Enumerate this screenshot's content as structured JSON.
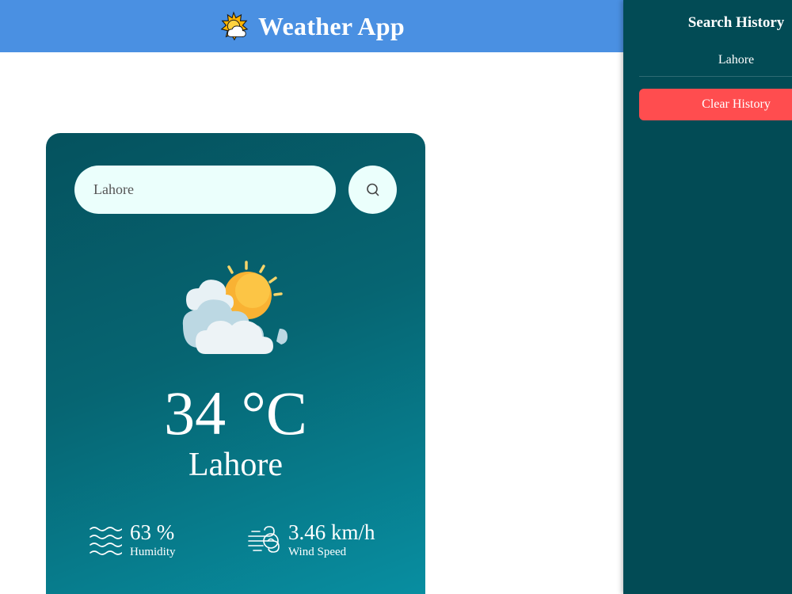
{
  "header": {
    "title": "Weather App",
    "logo_icon": "sun-cloud-icon",
    "background": "#4a90e2"
  },
  "sidebar": {
    "title": "Search History",
    "history": [
      {
        "city": "Lahore"
      }
    ],
    "clear_button_label": "Clear History",
    "background": "#024b55",
    "clear_button_color": "#ff4d4f"
  },
  "search": {
    "value": "Lahore",
    "button_icon": "search-icon"
  },
  "weather": {
    "icon": "partly-cloudy-icon",
    "temperature": "34 °C",
    "city": "Lahore",
    "humidity": {
      "value": "63 %",
      "label": "Humidity",
      "icon": "humidity-waves-icon"
    },
    "wind": {
      "value": "3.46 km/h",
      "label": "Wind Speed",
      "icon": "wind-icon"
    }
  }
}
